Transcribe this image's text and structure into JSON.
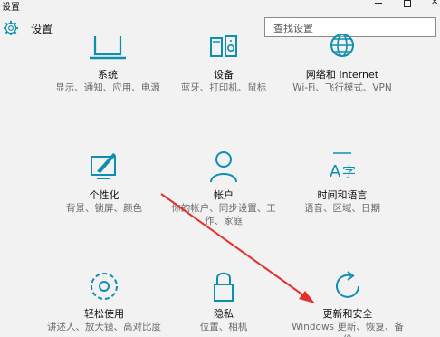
{
  "window": {
    "title": "设置"
  },
  "header": {
    "title": "设置"
  },
  "search": {
    "placeholder": "查找设置"
  },
  "tiles": [
    {
      "name": "系统",
      "desc": "显示、通知、应用、电源"
    },
    {
      "name": "设备",
      "desc": "蓝牙、打印机、鼠标"
    },
    {
      "name": "网络和 Internet",
      "desc": "Wi-Fi、飞行模式、VPN"
    },
    {
      "name": "个性化",
      "desc": "背景、锁屏、颜色"
    },
    {
      "name": "帐户",
      "desc": "你的帐户、同步设置、工作、家庭"
    },
    {
      "name": "时间和语言",
      "desc": "语音、区域、日期"
    },
    {
      "name": "轻松使用",
      "desc": "讲述人、放大镜、高对比度"
    },
    {
      "name": "隐私",
      "desc": "位置、相机"
    },
    {
      "name": "更新和安全",
      "desc": "Windows 更新、恢复、备份"
    }
  ],
  "colors": {
    "accent": "#0f8fb0",
    "arrow": "#e0322f"
  }
}
